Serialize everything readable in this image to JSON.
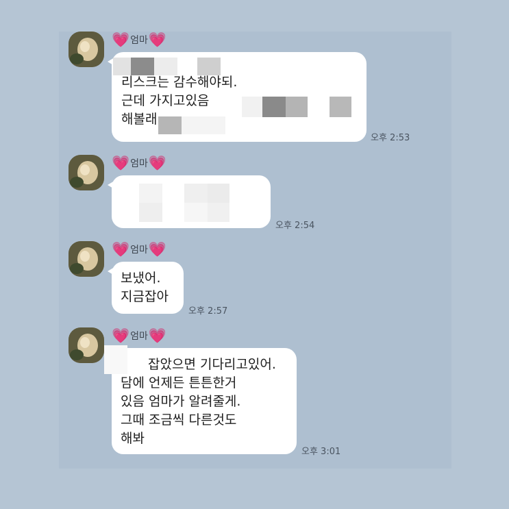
{
  "messages": [
    {
      "sender": {
        "heart_left": "💗",
        "name": "엄마",
        "heart_right": "💗"
      },
      "lines": [
        "",
        "리스크는 감수해야되.",
        "근데 가지고있음",
        "해볼래"
      ],
      "time": "오후 2:53"
    },
    {
      "sender": {
        "heart_left": "💗",
        "name": "엄마",
        "heart_right": "💗"
      },
      "lines": [
        ""
      ],
      "time": "오후 2:54"
    },
    {
      "sender": {
        "heart_left": "💗",
        "name": "엄마",
        "heart_right": "💗"
      },
      "lines": [
        "보냈어.",
        "지금잡아"
      ],
      "time": "오후 2:57"
    },
    {
      "sender": {
        "heart_left": "💗",
        "name": "엄마",
        "heart_right": "💗"
      },
      "lines": [
        "잡았으면 기다리고있어.",
        "담에 언제든 튼튼한거",
        "있음 엄마가 알려줄게.",
        "그때 조금씩 다른것도",
        "해봐"
      ],
      "time": "오후 3:01"
    }
  ],
  "colors": {
    "background": "#b5c5d4",
    "chat_panel": "#aebfd0",
    "bubble": "#ffffff",
    "heart": "#ff3aa8"
  }
}
